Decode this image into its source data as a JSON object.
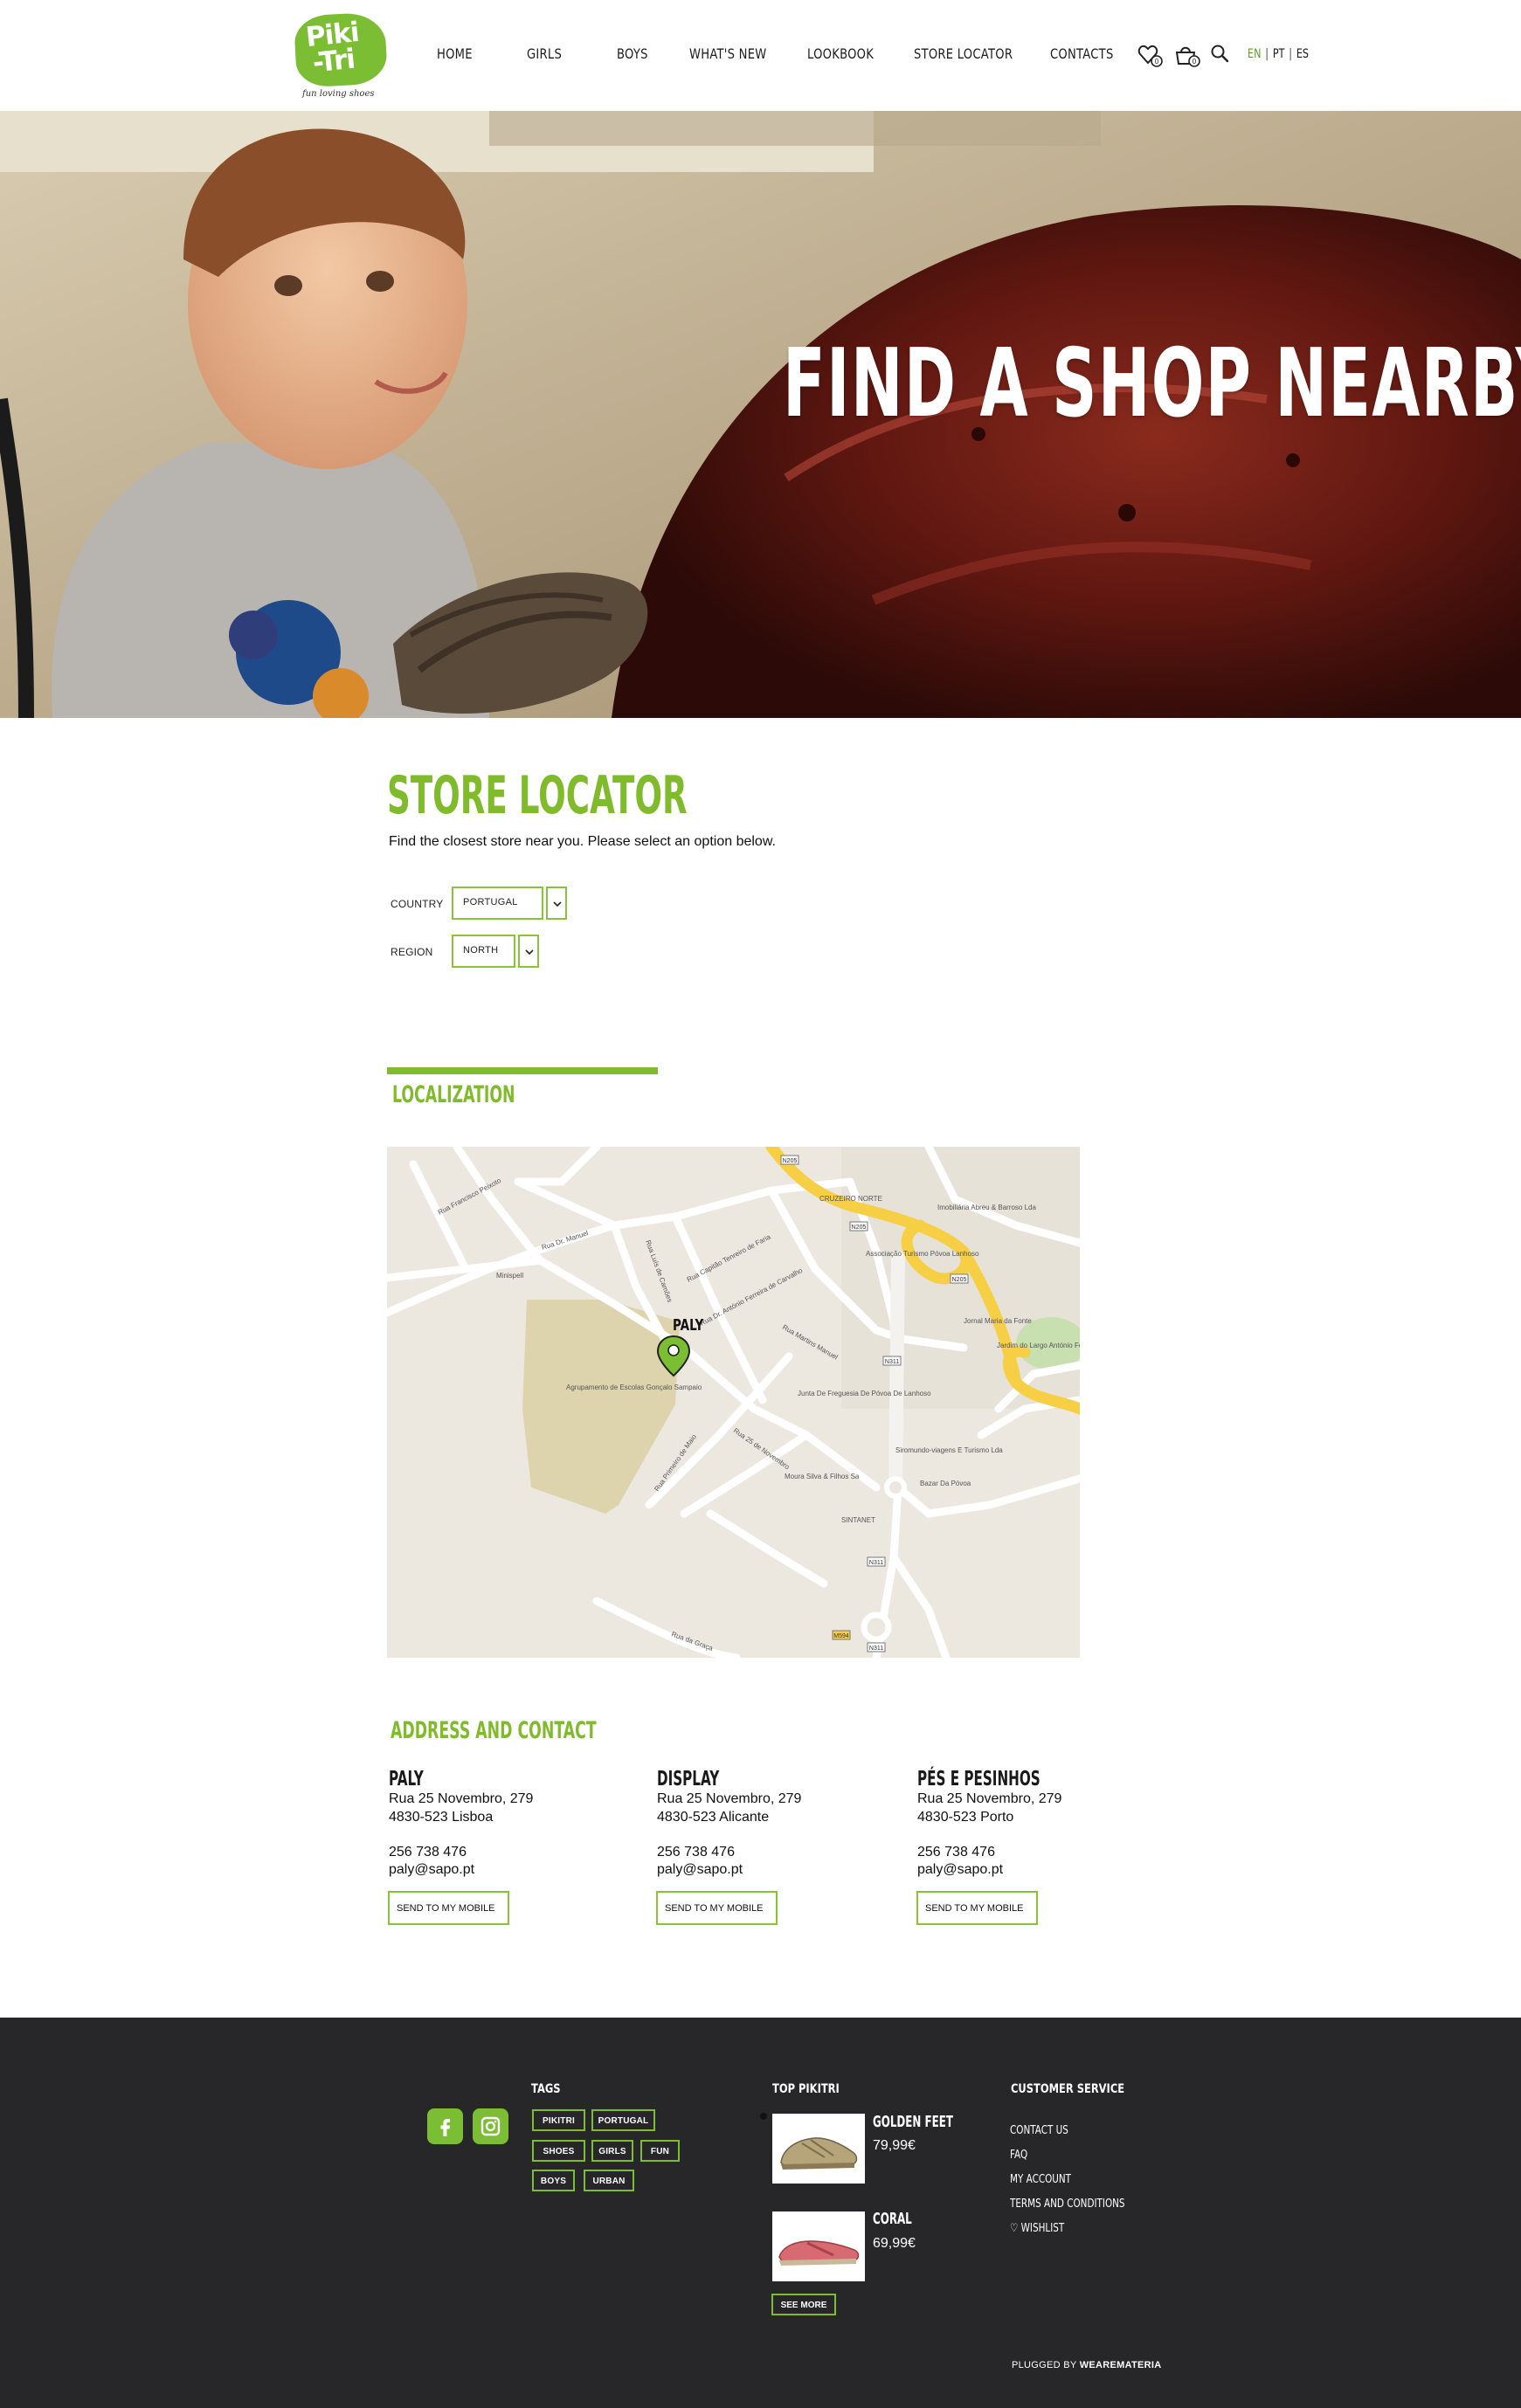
{
  "header": {
    "logo_text_top": "Piki",
    "logo_text_bottom": "-Tri",
    "logo_tagline": "fun loving shoes",
    "nav": [
      "HOME",
      "GIRLS",
      "BOYS",
      "WHAT'S NEW",
      "LOOKBOOK",
      "STORE LOCATOR",
      "CONTACTS"
    ],
    "icons": [
      "wishlist-icon",
      "cart-icon",
      "search-icon"
    ],
    "lang": {
      "en": "EN",
      "pt": "PT",
      "es": "ES",
      "sep": "|",
      "active": "EN"
    }
  },
  "hero": {
    "title": "FIND A SHOP NEARBY"
  },
  "store_locator": {
    "title": "STORE LOCATOR",
    "subtitle": "Find the closest store near you. Please select an option below.",
    "country_label": "COUNTRY",
    "country_value": "PORTUGAL",
    "region_label": "REGION",
    "region_value": "NORTH"
  },
  "localization": {
    "title": "LOCALIZATION",
    "map_pin_label": "PALY",
    "map_labels": {
      "l1": "Rua Francisco Peixoto",
      "l2": "Rua Dr. Manuel",
      "l3": "Minispell",
      "l4": "Agrupamento de Escolas Gonçalo Sampaio",
      "l5": "CRUZEIRO NORTE",
      "l6": "Imobiliária Abreu & Barroso Lda",
      "l7": "Associação Turismo Póvoa Lanhoso",
      "l8": "Jornal Maria da Fonte",
      "l9": "Jardim do Largo António Ferreira Lopes",
      "l10": "Junta De Freguesia De Póvoa De Lanhoso",
      "l11": "Siromundo-viagens E Turismo Lda",
      "l12": "Moura Silva & Filhos Sa",
      "l13": "Bazar Da Póvoa",
      "l14": "SINTANET",
      "l15": "Rua da Graça",
      "l16": "Rua Capitão Tenreiro de Faria",
      "l17": "Rua Primeiro de Maio",
      "l18": "Rua 25 de Novembro",
      "l19": "Rua Martins Manuel",
      "l20": "Rua Dr. António Ferreira de Carvalho",
      "l21": "Rua Luís de Camões",
      "r1": "N205",
      "r2": "N311",
      "r3": "M594"
    }
  },
  "address": {
    "title": "ADDRESS AND CONTACT",
    "stores": [
      {
        "name": "PALY",
        "street": "Rua 25 Novembro, 279",
        "city": "4830-523 Lisboa",
        "phone": "256 738 476",
        "email": "paly@sapo.pt",
        "button": "SEND TO MY MOBILE"
      },
      {
        "name": "DISPLAY",
        "street": "Rua 25 Novembro, 279",
        "city": "4830-523 Alicante",
        "phone": "256 738 476",
        "email": "paly@sapo.pt",
        "button": "SEND TO MY MOBILE"
      },
      {
        "name": "PÉS E PESINHOS",
        "street": "Rua 25 Novembro, 279",
        "city": "4830-523 Porto",
        "phone": "256 738 476",
        "email": "paly@sapo.pt",
        "button": "SEND TO MY MOBILE"
      }
    ]
  },
  "footer": {
    "tags_title": "TAGS",
    "tags": [
      "PIKITRI",
      "PORTUGAL",
      "SHOES",
      "GIRLS",
      "FUN",
      "BOYS",
      "URBAN"
    ],
    "top_title": "TOP PIKITRI",
    "top_products": [
      {
        "name": "GOLDEN FEET",
        "price": "79,99€"
      },
      {
        "name": "CORAL",
        "price": "69,99€"
      }
    ],
    "see_more": "SEE MORE",
    "cs_title": "CUSTOMER SERVICE",
    "cs_links": [
      "CONTACT US",
      "FAQ",
      "MY ACCOUNT",
      "TERMS AND CONDITIONS",
      "♡ WISHLIST"
    ],
    "plugged_prefix": "PLUGGED BY",
    "plugged_brand": "WEAREMATERIA"
  },
  "colors": {
    "brand_green": "#7bbd33",
    "footer_bg": "#272729"
  }
}
